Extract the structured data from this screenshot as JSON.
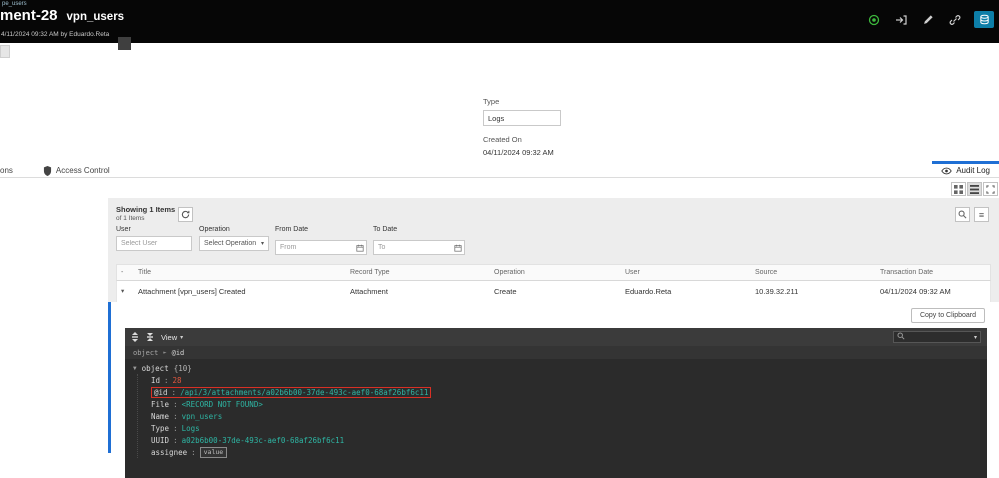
{
  "colors": {
    "header_bg": "#060606",
    "accent_blue": "#1f6fd4",
    "active_icon_bg": "#0d7ea8",
    "status_green": "#3db83d",
    "panel_bg": "#ededed",
    "json_bg": "#2b2b2b",
    "json_key": "#d8d8d8",
    "json_string": "#2eb6a4",
    "json_number": "#e2573f",
    "highlight_border": "#d93025"
  },
  "header": {
    "breadcrumb_partial": "pe_users",
    "title_partial": "ment-28",
    "record_name": "vpn_users",
    "meta": "4/11/2024 09:32 AM by Eduardo.Reta"
  },
  "details": {
    "type_label": "Type",
    "type_value": "Logs",
    "created_on_label": "Created On",
    "created_on_value": "04/11/2024 09:32 AM"
  },
  "tabs": {
    "partial_tab": "ons",
    "access_control": "Access Control",
    "audit_log": "Audit Log"
  },
  "audit_panel": {
    "showing_line1": "Showing 1 Items",
    "showing_line2": "of 1 Items",
    "filters": {
      "user_label": "User",
      "user_placeholder": "Select User",
      "operation_label": "Operation",
      "operation_value": "Select Operation",
      "from_label": "From Date",
      "from_placeholder": "From",
      "to_label": "To Date",
      "to_placeholder": "To"
    },
    "table": {
      "headers": [
        "-",
        "Title",
        "Record Type",
        "Operation",
        "User",
        "Source",
        "Transaction Date"
      ],
      "row": {
        "title": "Attachment [vpn_users] Created",
        "record_type": "Attachment",
        "operation": "Create",
        "user": "Eduardo.Reta",
        "source": "10.39.32.211",
        "transaction_date": "04/11/2024 09:32 AM"
      }
    },
    "copy_button": "Copy to Clipboard"
  },
  "json_viewer": {
    "view_label": "View",
    "breadcrumb": {
      "root": "object",
      "leaf": "@id"
    },
    "root_node": {
      "key": "object",
      "count": "{10}"
    },
    "fields": {
      "id": {
        "key": "Id",
        "value": "28"
      },
      "at_id": {
        "key": "@id",
        "value": "/api/3/attachments/a02b6b00-37de-493c-aef0-68af26bf6c11"
      },
      "file": {
        "key": "File",
        "value": "<RECORD NOT FOUND>"
      },
      "name": {
        "key": "Name",
        "value": "vpn_users"
      },
      "type": {
        "key": "Type",
        "value": "Logs"
      },
      "uuid": {
        "key": "UUID",
        "value": "a02b6b00-37de-493c-aef0-68af26bf6c11"
      },
      "assignee": {
        "key": "assignee",
        "chip": "value"
      }
    }
  },
  "glyphs": {
    "caret_down": "▾",
    "tree_expanded": "▼",
    "crumb_arrow": "►",
    "menu": "≡",
    "row_expanded": "▾"
  }
}
